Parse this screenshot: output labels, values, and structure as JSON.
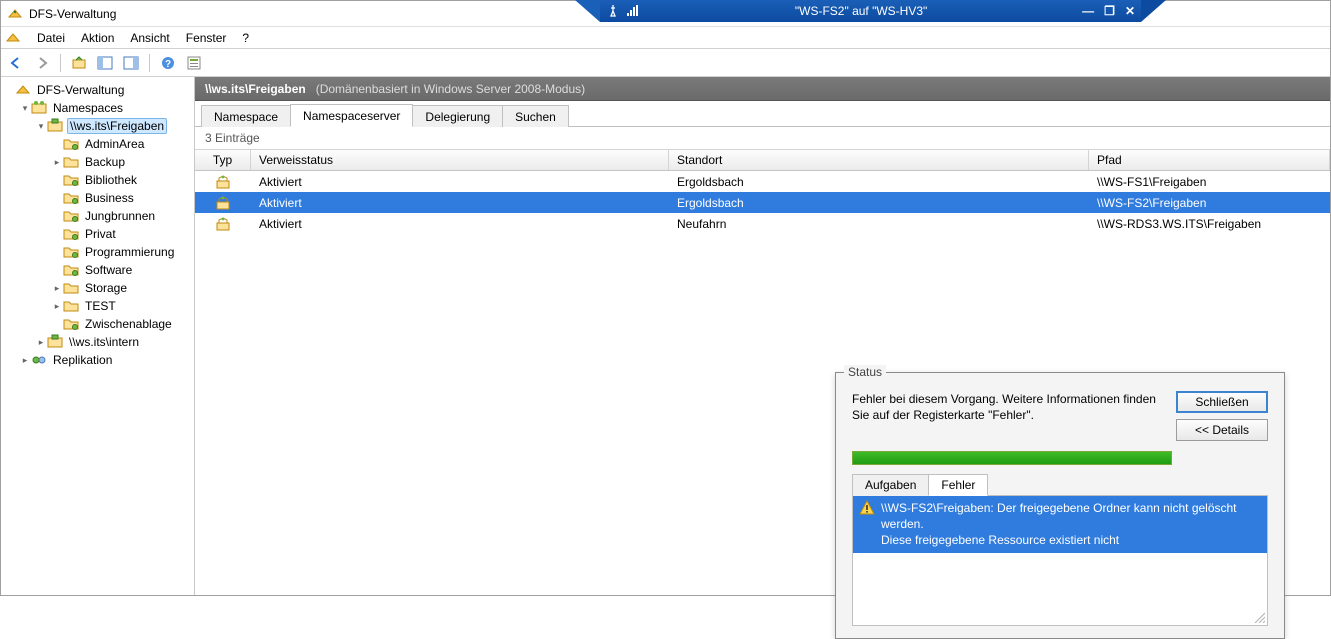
{
  "overlay": {
    "title": "\"WS-FS2\" auf \"WS-HV3\""
  },
  "window": {
    "title": "DFS-Verwaltung"
  },
  "menu": {
    "items": [
      "Datei",
      "Aktion",
      "Ansicht",
      "Fenster",
      "?"
    ]
  },
  "tree": {
    "root": "DFS-Verwaltung",
    "items": [
      {
        "label": "Namespaces",
        "indent": 1,
        "exp": "v",
        "icon": "namespace"
      },
      {
        "label": "\\\\ws.its\\Freigaben",
        "indent": 2,
        "exp": "v",
        "icon": "share",
        "selected": true
      },
      {
        "label": "AdminArea",
        "indent": 3,
        "exp": "",
        "icon": "folder-ns"
      },
      {
        "label": "Backup",
        "indent": 3,
        "exp": ">",
        "icon": "folder"
      },
      {
        "label": "Bibliothek",
        "indent": 3,
        "exp": "",
        "icon": "folder-ns"
      },
      {
        "label": "Business",
        "indent": 3,
        "exp": "",
        "icon": "folder-ns"
      },
      {
        "label": "Jungbrunnen",
        "indent": 3,
        "exp": "",
        "icon": "folder-ns"
      },
      {
        "label": "Privat",
        "indent": 3,
        "exp": "",
        "icon": "folder-ns"
      },
      {
        "label": "Programmierung",
        "indent": 3,
        "exp": "",
        "icon": "folder-ns"
      },
      {
        "label": "Software",
        "indent": 3,
        "exp": "",
        "icon": "folder-ns"
      },
      {
        "label": "Storage",
        "indent": 3,
        "exp": ">",
        "icon": "folder"
      },
      {
        "label": "TEST",
        "indent": 3,
        "exp": ">",
        "icon": "folder"
      },
      {
        "label": "Zwischenablage",
        "indent": 3,
        "exp": "",
        "icon": "folder-ns"
      },
      {
        "label": "\\\\ws.its\\intern",
        "indent": 2,
        "exp": ">",
        "icon": "share"
      },
      {
        "label": "Replikation",
        "indent": 1,
        "exp": ">",
        "icon": "replication"
      }
    ]
  },
  "pathbar": {
    "primary": "\\\\ws.its\\Freigaben",
    "secondary": "(Domänenbasiert in Windows Server 2008-Modus)"
  },
  "tabs": {
    "items": [
      "Namespace",
      "Namespaceserver",
      "Delegierung",
      "Suchen"
    ],
    "active": 1
  },
  "grid": {
    "count_label": "3 Einträge",
    "columns": [
      "Typ",
      "Verweisstatus",
      "Standort",
      "Pfad"
    ],
    "rows": [
      {
        "status": "Aktiviert",
        "standort": "Ergoldsbach",
        "pfad": "\\\\WS-FS1\\Freigaben",
        "selected": false
      },
      {
        "status": "Aktiviert",
        "standort": "Ergoldsbach",
        "pfad": "\\\\WS-FS2\\Freigaben",
        "selected": true
      },
      {
        "status": "Aktiviert",
        "standort": "Neufahrn",
        "pfad": "\\\\WS-RDS3.WS.ITS\\Freigaben",
        "selected": false
      }
    ]
  },
  "dialog": {
    "title": "Status",
    "message": "Fehler bei diesem Vorgang. Weitere Informationen finden Sie auf der Registerkarte \"Fehler\".",
    "close_btn": "Schließen",
    "details_btn": "<< Details",
    "sub_tabs": [
      "Aufgaben",
      "Fehler"
    ],
    "sub_active": 1,
    "error_line1": "\\\\WS-FS2\\Freigaben: Der freigegebene Ordner kann nicht gelöscht werden.",
    "error_line2": "Diese freigegebene Ressource existiert nicht"
  }
}
